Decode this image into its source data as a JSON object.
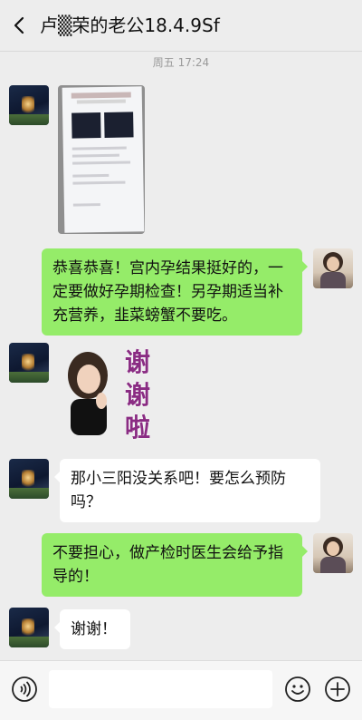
{
  "header": {
    "title": "卢▒荣的老公18.4.9Sf"
  },
  "chat": {
    "timestamp": "周五 17:24",
    "messages": [
      {
        "side": "in",
        "kind": "image"
      },
      {
        "side": "out",
        "kind": "text",
        "text": "恭喜恭喜！宫内孕结果挺好的，一定要做好孕期检查！另孕期适当补充营养，韭菜螃蟹不要吃。"
      },
      {
        "side": "in",
        "kind": "sticker",
        "text": [
          "谢",
          "谢",
          "啦"
        ]
      },
      {
        "side": "in",
        "kind": "text",
        "text": "那小三阳没关系吧！要怎么预防吗？"
      },
      {
        "side": "out",
        "kind": "text",
        "text": "不要担心，做产检时医生会给予指导的！"
      },
      {
        "side": "in",
        "kind": "text",
        "text": "谢谢！"
      }
    ]
  },
  "input_bar": {
    "placeholder": "",
    "icons": [
      "voice-icon",
      "emoji-icon",
      "plus-icon"
    ]
  },
  "colors": {
    "background": "#ededed",
    "outgoing_bubble": "#95ec69",
    "incoming_bubble": "#ffffff"
  }
}
